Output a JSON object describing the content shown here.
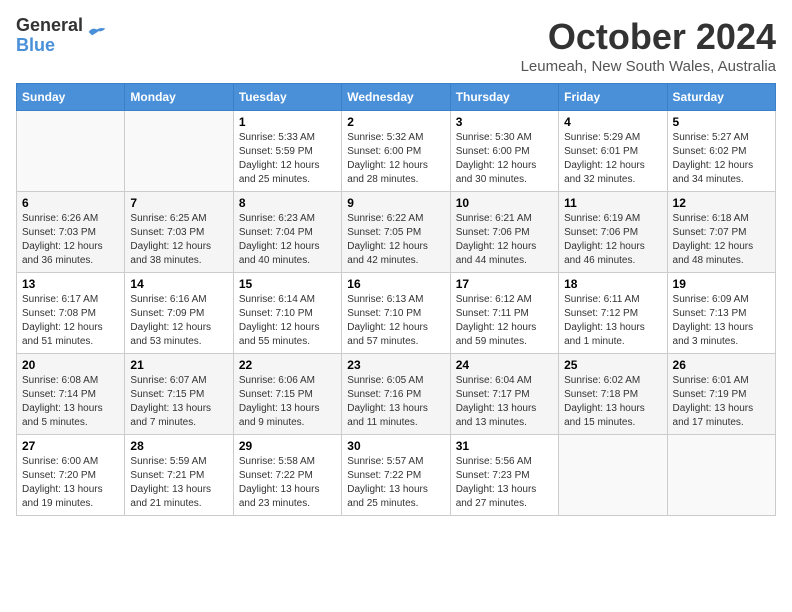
{
  "header": {
    "logo_line1": "General",
    "logo_line2": "Blue",
    "month": "October 2024",
    "location": "Leumeah, New South Wales, Australia"
  },
  "weekdays": [
    "Sunday",
    "Monday",
    "Tuesday",
    "Wednesday",
    "Thursday",
    "Friday",
    "Saturday"
  ],
  "weeks": [
    [
      {
        "day": "",
        "sunrise": "",
        "sunset": "",
        "daylight": ""
      },
      {
        "day": "",
        "sunrise": "",
        "sunset": "",
        "daylight": ""
      },
      {
        "day": "1",
        "sunrise": "Sunrise: 5:33 AM",
        "sunset": "Sunset: 5:59 PM",
        "daylight": "Daylight: 12 hours and 25 minutes."
      },
      {
        "day": "2",
        "sunrise": "Sunrise: 5:32 AM",
        "sunset": "Sunset: 6:00 PM",
        "daylight": "Daylight: 12 hours and 28 minutes."
      },
      {
        "day": "3",
        "sunrise": "Sunrise: 5:30 AM",
        "sunset": "Sunset: 6:00 PM",
        "daylight": "Daylight: 12 hours and 30 minutes."
      },
      {
        "day": "4",
        "sunrise": "Sunrise: 5:29 AM",
        "sunset": "Sunset: 6:01 PM",
        "daylight": "Daylight: 12 hours and 32 minutes."
      },
      {
        "day": "5",
        "sunrise": "Sunrise: 5:27 AM",
        "sunset": "Sunset: 6:02 PM",
        "daylight": "Daylight: 12 hours and 34 minutes."
      }
    ],
    [
      {
        "day": "6",
        "sunrise": "Sunrise: 6:26 AM",
        "sunset": "Sunset: 7:03 PM",
        "daylight": "Daylight: 12 hours and 36 minutes."
      },
      {
        "day": "7",
        "sunrise": "Sunrise: 6:25 AM",
        "sunset": "Sunset: 7:03 PM",
        "daylight": "Daylight: 12 hours and 38 minutes."
      },
      {
        "day": "8",
        "sunrise": "Sunrise: 6:23 AM",
        "sunset": "Sunset: 7:04 PM",
        "daylight": "Daylight: 12 hours and 40 minutes."
      },
      {
        "day": "9",
        "sunrise": "Sunrise: 6:22 AM",
        "sunset": "Sunset: 7:05 PM",
        "daylight": "Daylight: 12 hours and 42 minutes."
      },
      {
        "day": "10",
        "sunrise": "Sunrise: 6:21 AM",
        "sunset": "Sunset: 7:06 PM",
        "daylight": "Daylight: 12 hours and 44 minutes."
      },
      {
        "day": "11",
        "sunrise": "Sunrise: 6:19 AM",
        "sunset": "Sunset: 7:06 PM",
        "daylight": "Daylight: 12 hours and 46 minutes."
      },
      {
        "day": "12",
        "sunrise": "Sunrise: 6:18 AM",
        "sunset": "Sunset: 7:07 PM",
        "daylight": "Daylight: 12 hours and 48 minutes."
      }
    ],
    [
      {
        "day": "13",
        "sunrise": "Sunrise: 6:17 AM",
        "sunset": "Sunset: 7:08 PM",
        "daylight": "Daylight: 12 hours and 51 minutes."
      },
      {
        "day": "14",
        "sunrise": "Sunrise: 6:16 AM",
        "sunset": "Sunset: 7:09 PM",
        "daylight": "Daylight: 12 hours and 53 minutes."
      },
      {
        "day": "15",
        "sunrise": "Sunrise: 6:14 AM",
        "sunset": "Sunset: 7:10 PM",
        "daylight": "Daylight: 12 hours and 55 minutes."
      },
      {
        "day": "16",
        "sunrise": "Sunrise: 6:13 AM",
        "sunset": "Sunset: 7:10 PM",
        "daylight": "Daylight: 12 hours and 57 minutes."
      },
      {
        "day": "17",
        "sunrise": "Sunrise: 6:12 AM",
        "sunset": "Sunset: 7:11 PM",
        "daylight": "Daylight: 12 hours and 59 minutes."
      },
      {
        "day": "18",
        "sunrise": "Sunrise: 6:11 AM",
        "sunset": "Sunset: 7:12 PM",
        "daylight": "Daylight: 13 hours and 1 minute."
      },
      {
        "day": "19",
        "sunrise": "Sunrise: 6:09 AM",
        "sunset": "Sunset: 7:13 PM",
        "daylight": "Daylight: 13 hours and 3 minutes."
      }
    ],
    [
      {
        "day": "20",
        "sunrise": "Sunrise: 6:08 AM",
        "sunset": "Sunset: 7:14 PM",
        "daylight": "Daylight: 13 hours and 5 minutes."
      },
      {
        "day": "21",
        "sunrise": "Sunrise: 6:07 AM",
        "sunset": "Sunset: 7:15 PM",
        "daylight": "Daylight: 13 hours and 7 minutes."
      },
      {
        "day": "22",
        "sunrise": "Sunrise: 6:06 AM",
        "sunset": "Sunset: 7:15 PM",
        "daylight": "Daylight: 13 hours and 9 minutes."
      },
      {
        "day": "23",
        "sunrise": "Sunrise: 6:05 AM",
        "sunset": "Sunset: 7:16 PM",
        "daylight": "Daylight: 13 hours and 11 minutes."
      },
      {
        "day": "24",
        "sunrise": "Sunrise: 6:04 AM",
        "sunset": "Sunset: 7:17 PM",
        "daylight": "Daylight: 13 hours and 13 minutes."
      },
      {
        "day": "25",
        "sunrise": "Sunrise: 6:02 AM",
        "sunset": "Sunset: 7:18 PM",
        "daylight": "Daylight: 13 hours and 15 minutes."
      },
      {
        "day": "26",
        "sunrise": "Sunrise: 6:01 AM",
        "sunset": "Sunset: 7:19 PM",
        "daylight": "Daylight: 13 hours and 17 minutes."
      }
    ],
    [
      {
        "day": "27",
        "sunrise": "Sunrise: 6:00 AM",
        "sunset": "Sunset: 7:20 PM",
        "daylight": "Daylight: 13 hours and 19 minutes."
      },
      {
        "day": "28",
        "sunrise": "Sunrise: 5:59 AM",
        "sunset": "Sunset: 7:21 PM",
        "daylight": "Daylight: 13 hours and 21 minutes."
      },
      {
        "day": "29",
        "sunrise": "Sunrise: 5:58 AM",
        "sunset": "Sunset: 7:22 PM",
        "daylight": "Daylight: 13 hours and 23 minutes."
      },
      {
        "day": "30",
        "sunrise": "Sunrise: 5:57 AM",
        "sunset": "Sunset: 7:22 PM",
        "daylight": "Daylight: 13 hours and 25 minutes."
      },
      {
        "day": "31",
        "sunrise": "Sunrise: 5:56 AM",
        "sunset": "Sunset: 7:23 PM",
        "daylight": "Daylight: 13 hours and 27 minutes."
      },
      {
        "day": "",
        "sunrise": "",
        "sunset": "",
        "daylight": ""
      },
      {
        "day": "",
        "sunrise": "",
        "sunset": "",
        "daylight": ""
      }
    ]
  ]
}
